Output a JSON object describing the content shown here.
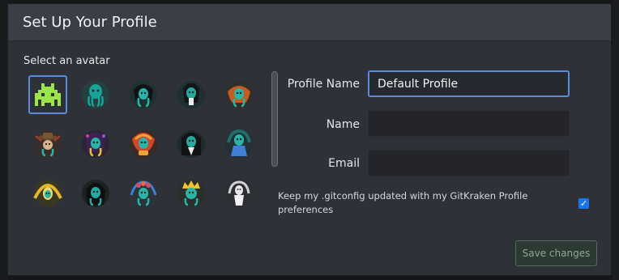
{
  "modal": {
    "title": "Set Up Your Profile"
  },
  "avatars": {
    "label": "Select an avatar",
    "items": [
      {
        "name": "space-invader-avatar",
        "selected": true
      },
      {
        "name": "kraken-teal-avatar",
        "selected": false
      },
      {
        "name": "kraken-dark-hair-avatar",
        "selected": false
      },
      {
        "name": "kraken-skull-avatar",
        "selected": false
      },
      {
        "name": "kraken-orange-avatar",
        "selected": false
      },
      {
        "name": "kraken-cowboy-avatar",
        "selected": false
      },
      {
        "name": "kraken-wizard-avatar",
        "selected": false
      },
      {
        "name": "kraken-fire-avatar",
        "selected": false
      },
      {
        "name": "kraken-suit-avatar",
        "selected": false
      },
      {
        "name": "kraken-blue-dress-avatar",
        "selected": false
      },
      {
        "name": "kraken-gold-avatar",
        "selected": false
      },
      {
        "name": "kraken-black-hood-avatar",
        "selected": false
      },
      {
        "name": "kraken-flower-avatar",
        "selected": false
      },
      {
        "name": "kraken-yellow-hair-avatar",
        "selected": false
      },
      {
        "name": "kraken-white-robe-avatar",
        "selected": false
      }
    ]
  },
  "form": {
    "profile_name_label": "Profile Name",
    "profile_name_value": "Default Profile",
    "name_label": "Name",
    "name_value": "",
    "email_label": "Email",
    "email_value": ""
  },
  "gitconfig": {
    "label": "Keep my .gitconfig updated with my GitKraken Profile preferences",
    "checked": true
  },
  "actions": {
    "save_label": "Save changes"
  },
  "colors": {
    "accent": "#5b8bd9",
    "checkbox": "#1a73e8",
    "save_border": "#4f6e5c"
  }
}
